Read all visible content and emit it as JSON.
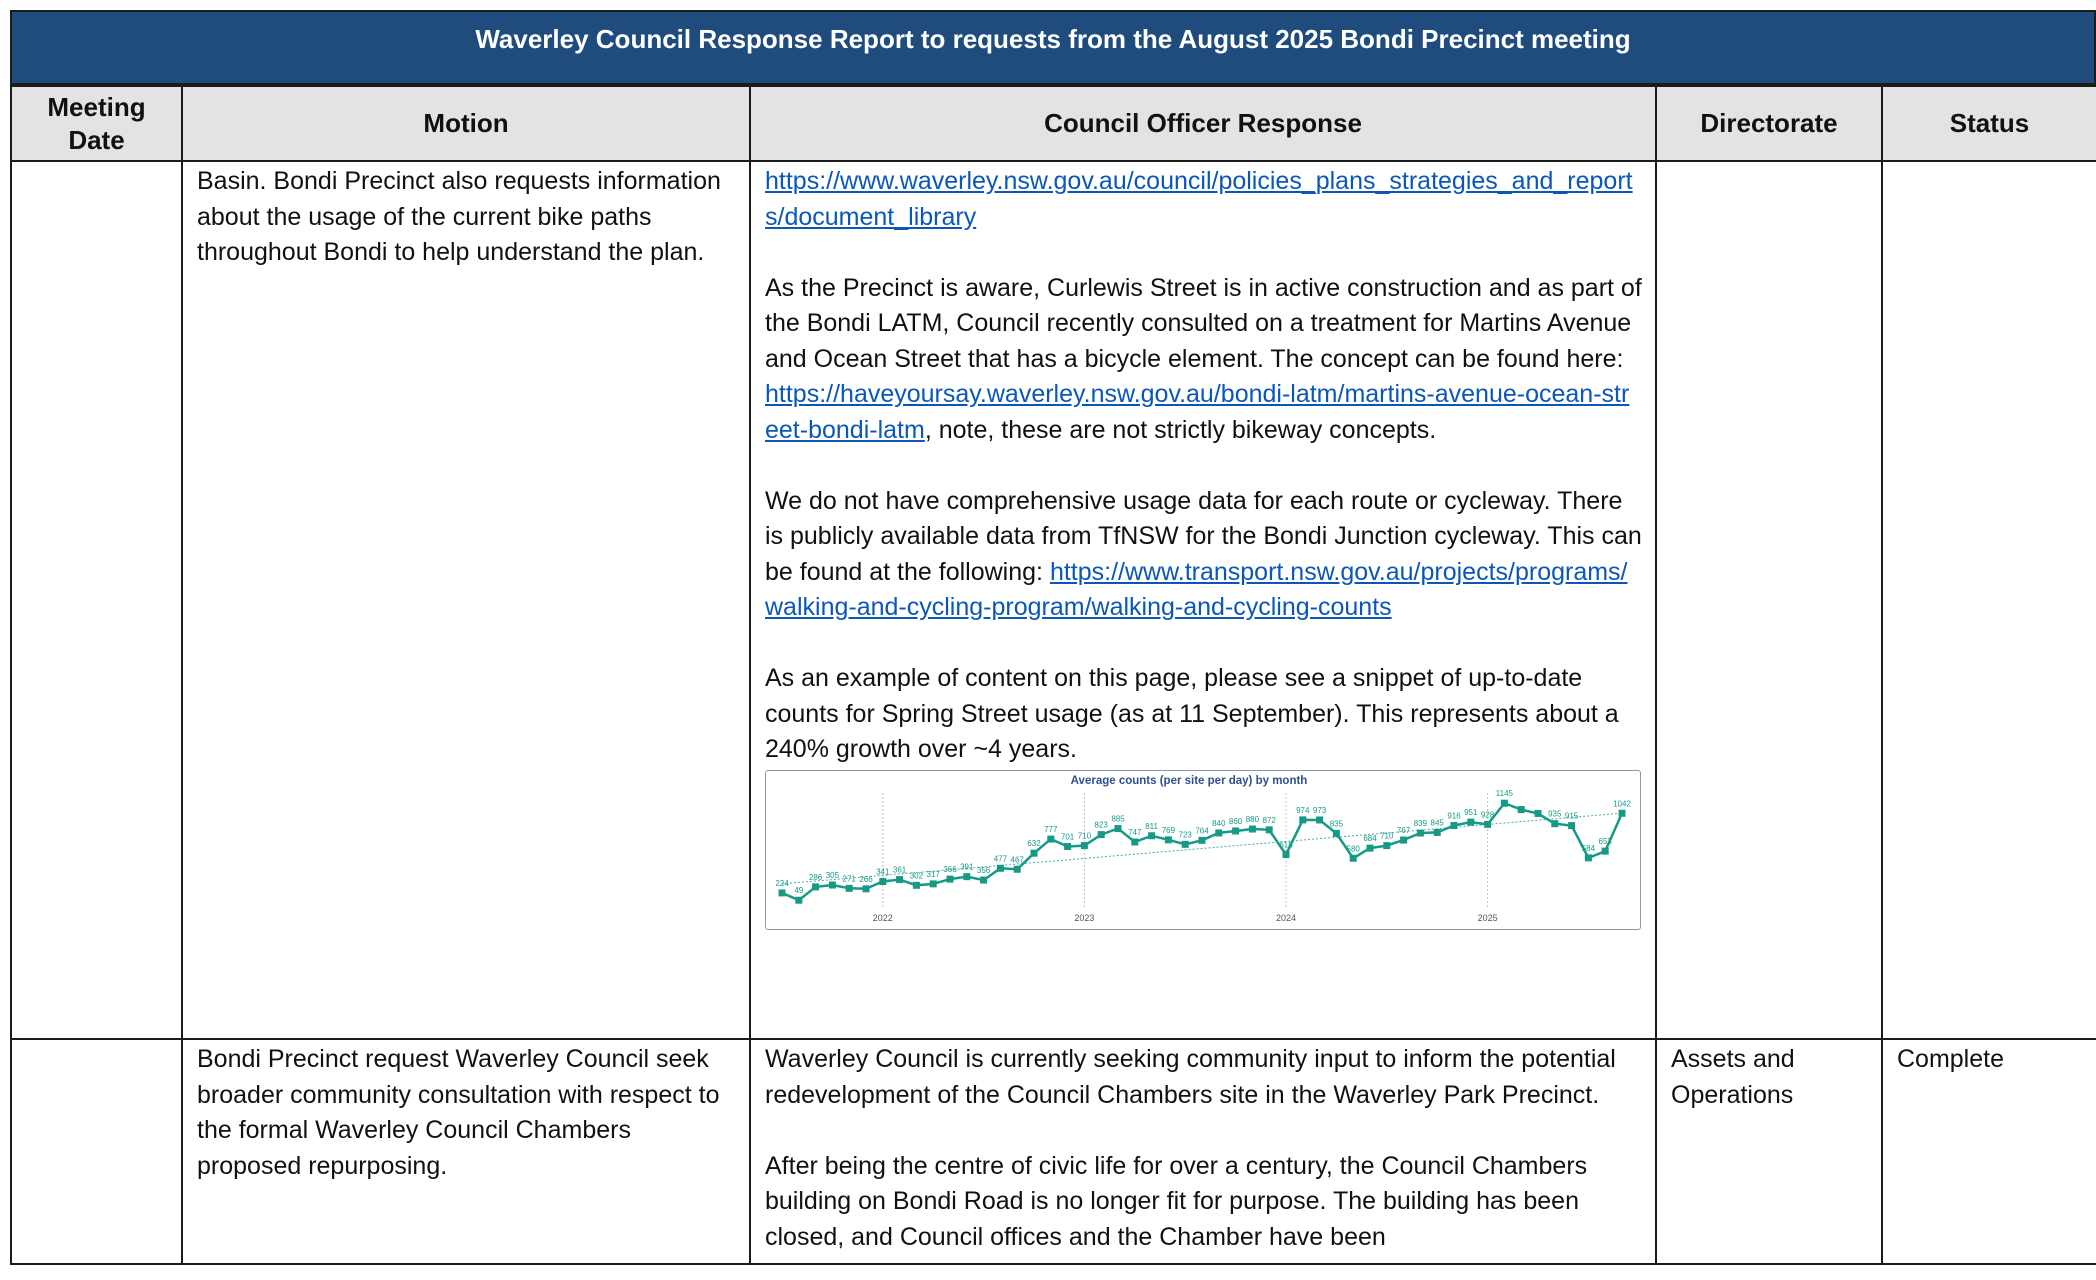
{
  "header": {
    "title": "Waverley Council Response Report to requests from the August 2025 Bondi Precinct meeting"
  },
  "columns": [
    "Meeting Date",
    "Motion",
    "Council Officer Response",
    "Directorate",
    "Status"
  ],
  "rows": [
    {
      "meeting_date": "",
      "motion": "Basin. Bondi Precinct also requests information about the usage of the current bike paths throughout Bondi to help understand the plan.",
      "response": {
        "link1": "https://www.waverley.nsw.gov.au/council/policies_plans_strategies_and_reports/document_library",
        "p2": "As the Precinct is aware, Curlewis Street is in active construction and as part of the Bondi LATM, Council recently consulted on a treatment for Martins Avenue and Ocean Street that has a bicycle element. The concept can be found here:",
        "link2": "https://haveyoursay.waverley.nsw.gov.au/bondi-latm/martins-avenue-ocean-street-bondi-latm",
        "p2_after": ", note, these are not strictly bikeway concepts.",
        "p3": "We do not have comprehensive usage data for each route or cycleway. There is publicly available data from TfNSW for the Bondi Junction cycleway. This can be found at the following:",
        "link3": "https://www.transport.nsw.gov.au/projects/programs/walking-and-cycling-program/walking-and-cycling-counts",
        "p4": "As an example of content on this page, please see a snippet of up-to-date counts for Spring Street usage (as at 11 September). This represents about a 240% growth over ~4 years."
      },
      "directorate": "",
      "status": ""
    },
    {
      "meeting_date": "",
      "motion": "Bondi Precinct request Waverley Council seek broader community consultation with respect to the formal Waverley Council Chambers proposed repurposing.",
      "response": {
        "p1": "Waverley Council is currently seeking community input to inform the potential redevelopment of the Council Chambers site in the Waverley Park Precinct.",
        "p2": "After being the centre of civic life for over a century, the Council Chambers building on Bondi Road is no longer fit for purpose. The building has been closed, and Council offices and the Chamber have been"
      },
      "directorate": "Assets and Operations",
      "status": "Complete"
    }
  ],
  "chart_data": {
    "type": "line",
    "title": "Average counts (per site per day) by month",
    "x_tick_labels": [
      "2022",
      "2023",
      "2024",
      "2025"
    ],
    "x_tick_positions": [
      6,
      18,
      30,
      42
    ],
    "values": [
      224,
      149,
      286,
      305,
      271,
      266,
      341,
      361,
      302,
      317,
      366,
      391,
      356,
      477,
      467,
      632,
      777,
      701,
      710,
      823,
      885,
      747,
      811,
      769,
      723,
      764,
      840,
      860,
      880,
      872,
      618,
      974,
      973,
      835,
      580,
      684,
      710,
      767,
      839,
      845,
      916,
      951,
      928,
      1145,
      1080,
      1040,
      935,
      915,
      584,
      653,
      1042
    ],
    "labeled_values": [
      "224",
      "49",
      "286",
      "305",
      "271",
      "266",
      "341",
      "361",
      "302",
      "317",
      "366",
      "391",
      "356",
      "477",
      "467",
      "632",
      "777",
      "701",
      "710",
      "823",
      "885",
      "747",
      "811",
      "769",
      "723",
      "764",
      "840",
      "860",
      "880",
      "872",
      "618",
      "974",
      "973",
      "835",
      "580",
      "684",
      "710",
      "767",
      "839",
      "845",
      "916",
      "951",
      "928",
      "1145",
      "",
      "",
      "935",
      "915",
      "584",
      "653",
      "1042"
    ],
    "ylim": [
      100,
      1250
    ],
    "trendline": true,
    "colors": {
      "series": "#169a86",
      "label": "#169a86",
      "title": "#2f4f8f",
      "grid": "#c4c4c4",
      "axis_text": "#555555"
    }
  }
}
